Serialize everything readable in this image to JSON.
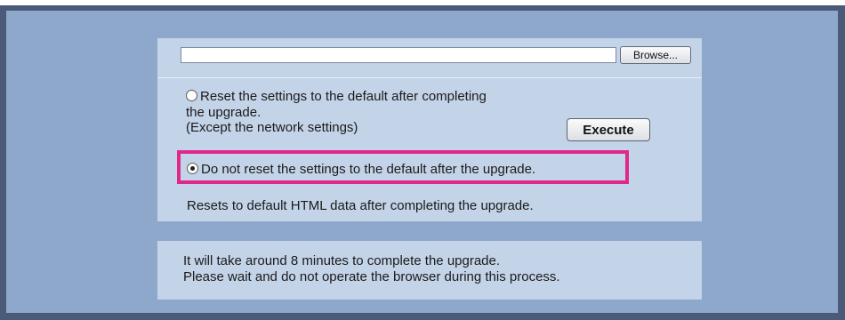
{
  "upload": {
    "file_value": "",
    "browse_label": "Browse..."
  },
  "options": {
    "reset_line1": "Reset the settings to the default after completing",
    "reset_line2": "the upgrade.",
    "reset_line3": "(Except the network settings)",
    "reset_selected": false,
    "no_reset_label": "Do not reset the settings to the default after the upgrade.",
    "no_reset_selected": true,
    "highlight_color": "#e0288a"
  },
  "execute_label": "Execute",
  "note": "Resets to default HTML data after completing the upgrade.",
  "info": {
    "line1": "It will take around 8 minutes to complete the upgrade.",
    "line2": "Please wait and do not operate the browser during this process."
  }
}
